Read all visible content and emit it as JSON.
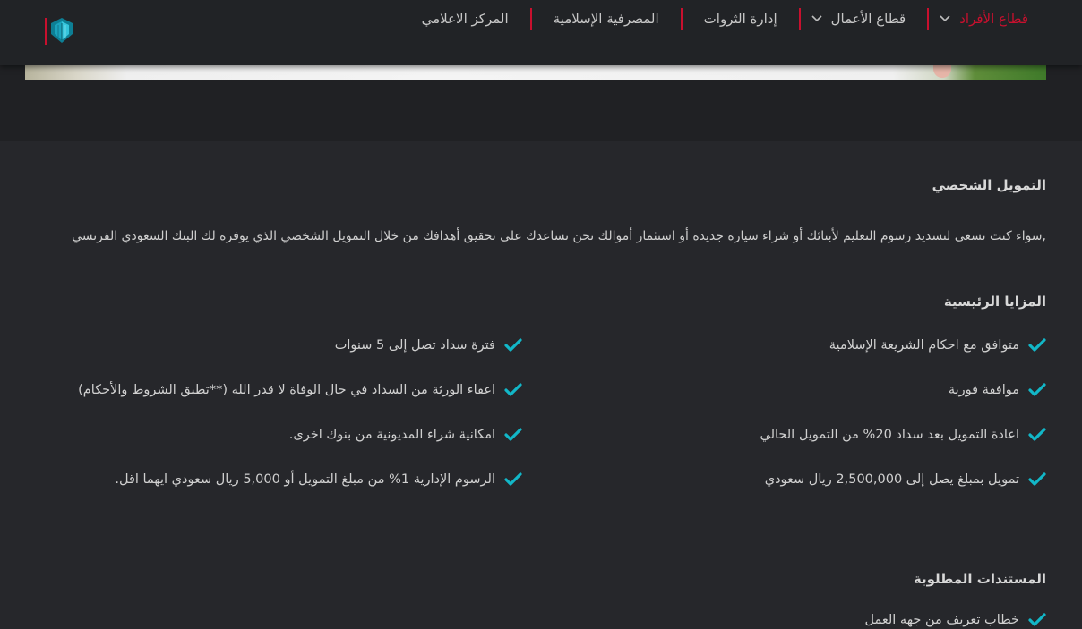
{
  "colors": {
    "brand_red": "#c8102e",
    "check_teal": "#12b7c8",
    "background": "#202124",
    "section": "#26272b"
  },
  "header": {
    "logo_icon": "bank-logo-icon",
    "nav": [
      {
        "label": "قطاع الأفراد",
        "active": true,
        "has_dropdown": true
      },
      {
        "label": "قطاع الأعمال",
        "active": false,
        "has_dropdown": true
      },
      {
        "label": "إدارة الثروات",
        "active": false,
        "has_dropdown": false
      },
      {
        "label": "المصرفية الإسلامية",
        "active": false,
        "has_dropdown": false
      },
      {
        "label": "المركز الاعلامي",
        "active": false,
        "has_dropdown": false
      }
    ]
  },
  "main": {
    "title": "التمويل الشخصي",
    "intro": ",سواء كنت تسعى لتسديد رسوم التعليم لأبنائك أو شراء سيارة جديدة أو استثمار أموالك نحن نساعدك على تحقيق أهدافك من خلال التمويل الشخصي الذي يوفره لك البنك السعودي الفرنسي",
    "features_title": "المزايا الرئيسية",
    "features_right": [
      "متوافق مع احكام الشريعة الإسلامية",
      "موافقة فورية",
      "اعادة التمويل بعد سداد 20% من التمويل الحالي",
      "تمويل بمبلغ يصل إلى 2,500,000 ريال سعودي"
    ],
    "features_left": [
      "فترة سداد تصل إلى 5 سنوات",
      "اعفاء الورثة من السداد في حال الوفاة لا قدر الله (**تطبق الشروط والأحكام)",
      "امكانية شراء المديونية من بنوك اخرى.",
      "الرسوم الإدارية 1% من مبلغ التمويل أو 5,000 ريال سعودي ايهما اقل."
    ],
    "documents_title": "المستندات المطلوبة",
    "documents": [
      "خطاب تعريف من جهه العمل"
    ]
  }
}
